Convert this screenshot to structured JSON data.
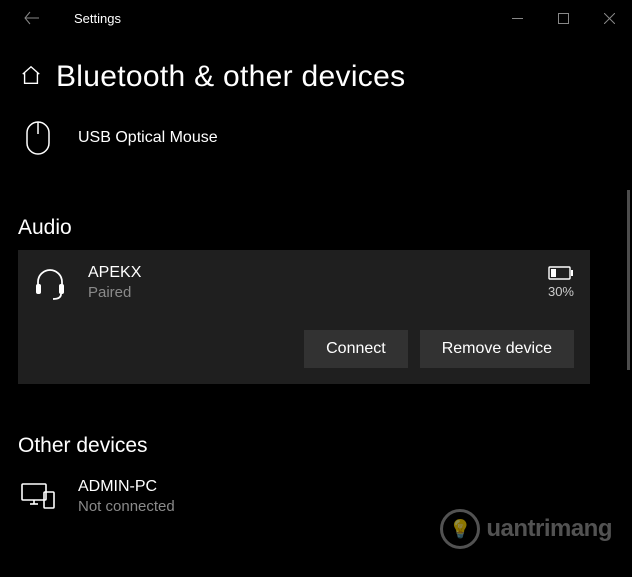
{
  "window": {
    "app_title": "Settings"
  },
  "page": {
    "title": "Bluetooth & other devices"
  },
  "mouse_section": {
    "device": {
      "name": "USB Optical Mouse"
    }
  },
  "audio_section": {
    "title": "Audio",
    "device": {
      "name": "APEKX",
      "status": "Paired",
      "battery_pct": "30%"
    },
    "actions": {
      "connect": "Connect",
      "remove": "Remove device"
    }
  },
  "other_section": {
    "title": "Other devices",
    "device": {
      "name": "ADMIN-PC",
      "status": "Not connected"
    }
  },
  "watermark": "uantrimang"
}
